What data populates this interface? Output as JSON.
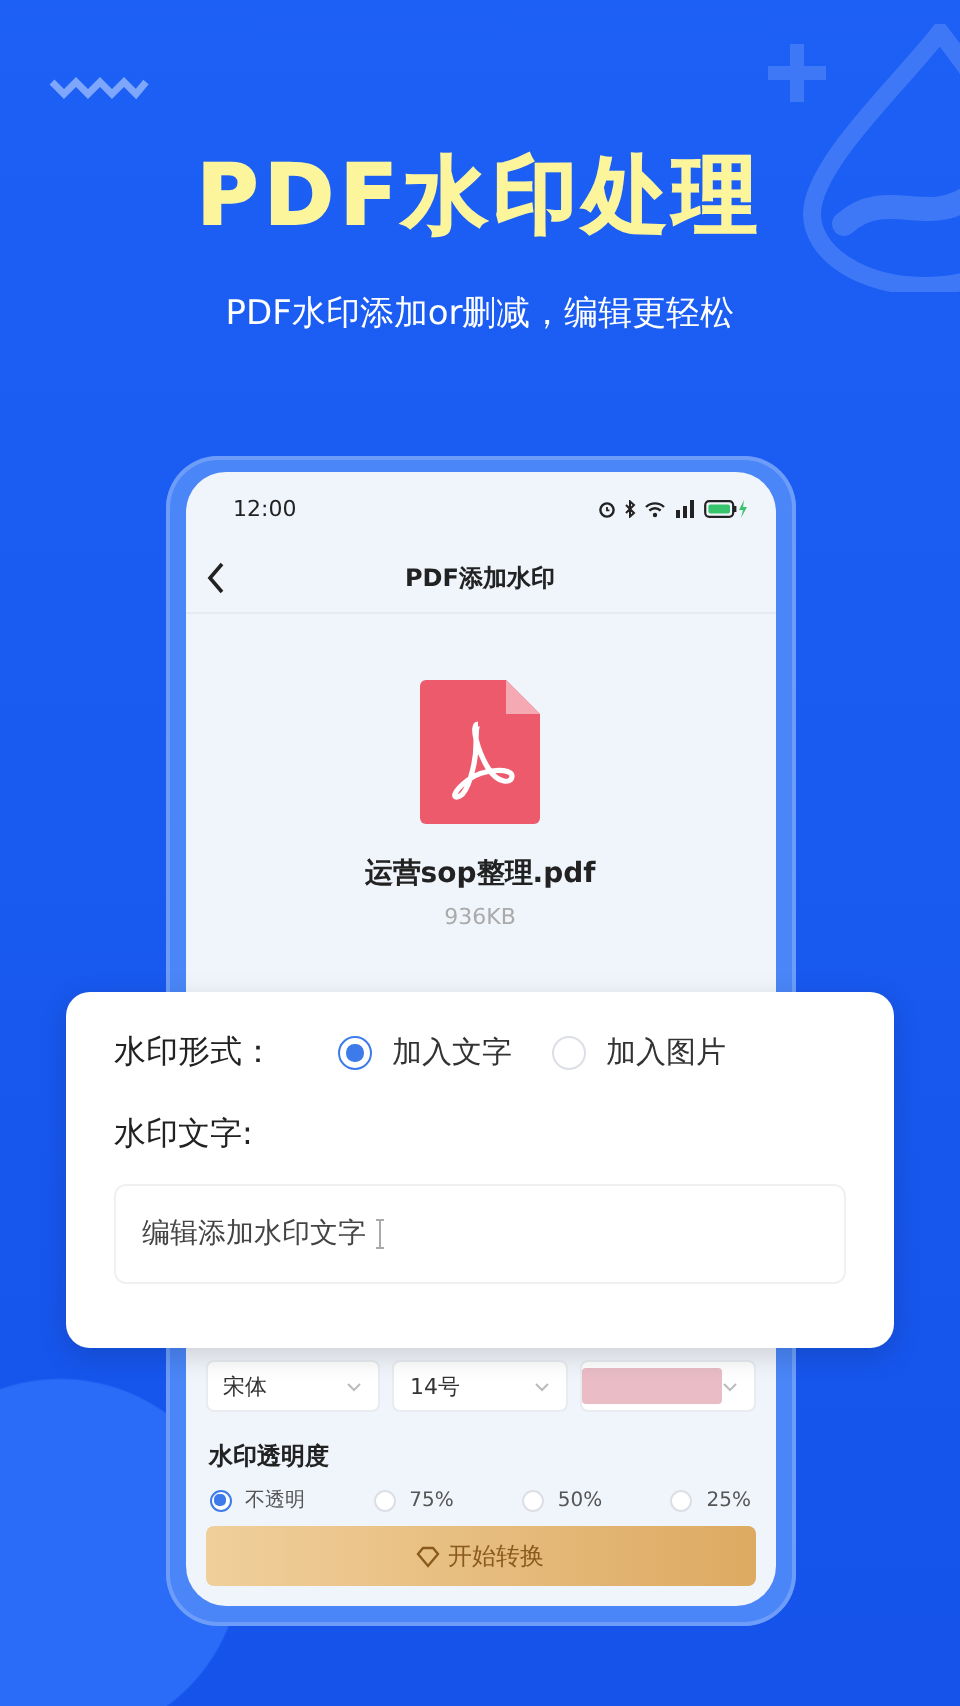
{
  "headline": "PDF水印处理",
  "subheadline": "PDF水印添加or删减，编辑更轻松",
  "phone": {
    "status_bar": {
      "time": "12:00"
    },
    "nav": {
      "title": "PDF添加水印"
    },
    "file": {
      "name": "运营sop整理.pdf",
      "size": "936KB"
    },
    "font_settings": [
      {
        "kind": "select",
        "label": "宋体"
      },
      {
        "kind": "select",
        "label": "14号"
      },
      {
        "kind": "color",
        "color": "#e9bcc6"
      }
    ],
    "opacity": {
      "label": "水印透明度",
      "options": [
        {
          "label": "不透明",
          "selected": true
        },
        {
          "label": "75%",
          "selected": false
        },
        {
          "label": "50%",
          "selected": false
        },
        {
          "label": "25%",
          "selected": false
        }
      ]
    },
    "convert_button": {
      "label": "开始转换"
    }
  },
  "watermark_card": {
    "type_label": "水印形式：",
    "type_options": [
      {
        "label": "加入文字",
        "selected": true
      },
      {
        "label": "加入图片",
        "selected": false
      }
    ],
    "text_label": "水印文字:",
    "text_input": {
      "value": "编辑添加水印文字"
    }
  }
}
